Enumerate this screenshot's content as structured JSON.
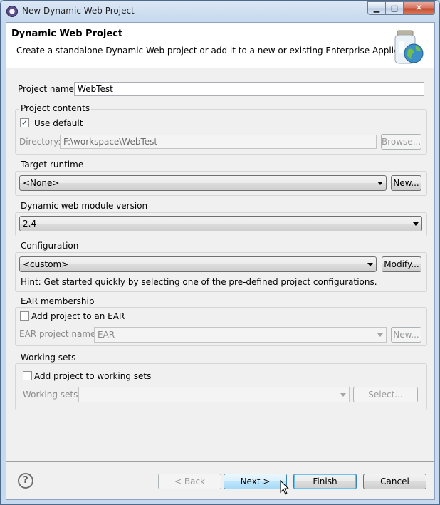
{
  "window": {
    "title": "New Dynamic Web Project"
  },
  "header": {
    "title": "Dynamic Web Project",
    "description": "Create a standalone Dynamic Web project or add it to a new or existing Enterprise Application."
  },
  "project_name": {
    "label": "Project name:",
    "value": "WebTest"
  },
  "project_contents": {
    "title": "Project contents",
    "use_default_label": "Use default",
    "use_default_checked": true,
    "directory_label": "Directory:",
    "directory_value": "F:\\workspace\\WebTest",
    "browse_label": "Browse..."
  },
  "target_runtime": {
    "title": "Target runtime",
    "selected": "<None>",
    "new_label": "New..."
  },
  "module_version": {
    "title": "Dynamic web module version",
    "selected": "2.4"
  },
  "configuration": {
    "title": "Configuration",
    "selected": "<custom>",
    "modify_label": "Modify...",
    "hint": "Hint: Get started quickly by selecting one of the pre-defined project configurations."
  },
  "ear_membership": {
    "title": "EAR membership",
    "add_label": "Add project to an EAR",
    "add_checked": false,
    "project_name_label": "EAR project name:",
    "project_name_value": "EAR",
    "new_label": "New..."
  },
  "working_sets": {
    "title": "Working sets",
    "add_label": "Add project to working sets",
    "add_checked": false,
    "sets_label": "Working sets:",
    "sets_value": "",
    "select_label": "Select..."
  },
  "footer": {
    "help_glyph": "?",
    "back_label": "< Back",
    "next_label": "Next >",
    "finish_label": "Finish",
    "cancel_label": "Cancel"
  },
  "icons": {
    "window": "eclipse-icon",
    "header": "web-project-jar-globe-icon",
    "help": "help-icon",
    "cursor": "mouse-pointer-icon"
  }
}
